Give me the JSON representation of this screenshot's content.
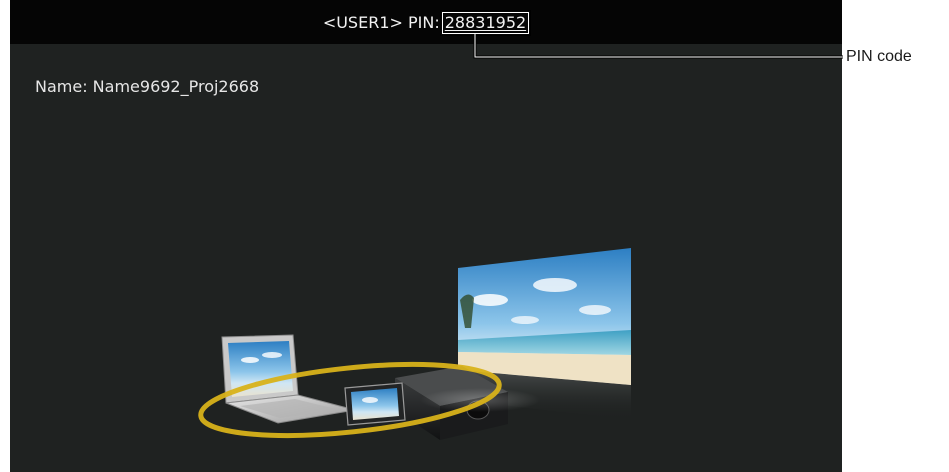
{
  "header": {
    "user": "<USER1>",
    "pin_prefix": "PIN:",
    "pin_code": "28831952"
  },
  "info": {
    "name_line": "Name: Name9692_Proj2668"
  },
  "callout": {
    "label": "PIN code"
  },
  "colors": {
    "screen_bg": "#1f2221",
    "topbar_bg": "#050505",
    "ring": "#d8b21a"
  }
}
